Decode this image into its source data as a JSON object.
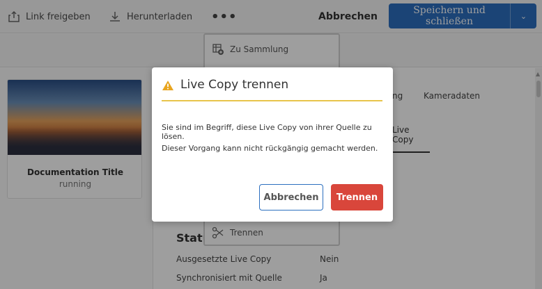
{
  "toolbar": {
    "share_link": "Link freigeben",
    "download": "Herunterladen",
    "more": "•••",
    "cancel": "Abbrechen",
    "save_close": "Speichern und schließen"
  },
  "menu": {
    "items": [
      "Zu Sammlung",
      "Trennen"
    ]
  },
  "card": {
    "title": "Documentation Title",
    "status": "running"
  },
  "tabs": {
    "partial": "ng",
    "camera": "Kameradaten",
    "live_copy": "Live Copy"
  },
  "properties": {
    "heading": "Statu",
    "rows": [
      {
        "label": "Ausgesetzte Live Copy",
        "value": "Nein"
      },
      {
        "label": "Synchronisiert mit Quelle",
        "value": "Ja"
      }
    ]
  },
  "dialog": {
    "title": "Live Copy trennen",
    "text1": "Sie sind im Begriff, diese Live Copy von ihrer Quelle zu lösen.",
    "text2": "Dieser Vorgang kann nicht rückgängig gemacht werden.",
    "cancel_label": "Abbrechen",
    "confirm_label": "Trennen",
    "accent": "#e8c44a",
    "danger": "#d9463b"
  }
}
